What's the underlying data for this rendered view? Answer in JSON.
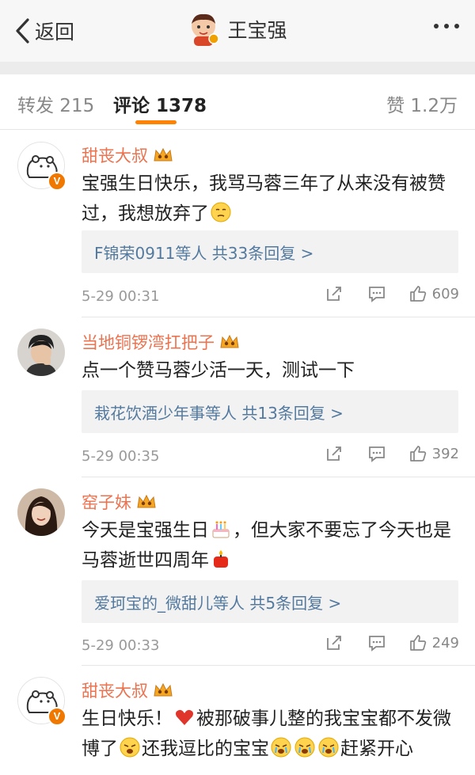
{
  "navbar": {
    "back_label": "返回",
    "title": "王宝强",
    "icons": [
      "back-chevron-icon",
      "user-avatar",
      "more-dots-icon"
    ]
  },
  "tabs": {
    "repost": "转发 215",
    "comments": "评论 1378",
    "likes": "赞 1.2万",
    "accent_color": "#ff8200"
  },
  "colors": {
    "username": "#eb7350",
    "link": "#53799e",
    "verified_badge": "#f07800",
    "heart": "#e0352b"
  },
  "comments": [
    {
      "name": "甜丧大叔",
      "text_a": "宝强生日快乐，我骂马蓉三年了从来没有被赞过，我想放弃了",
      "reply": "F锦荣0911等人  共33条回复 >",
      "time": "5-29 00:31",
      "likes": "609"
    },
    {
      "name": "当地铜锣湾扛把子",
      "text_a": "点一个赞马蓉少活一天，测试一下",
      "reply": "栽花饮酒少年事等人  共13条回复 >",
      "time": "5-29 00:35",
      "likes": "392"
    },
    {
      "name": "窑子妹",
      "text_a": "今天是宝强生日",
      "text_b": "，但大家不要忘了今天也是马蓉逝世四周年",
      "reply": "爱珂宝的_微甜儿等人  共5条回复 >",
      "time": "5-29 00:33",
      "likes": "249"
    },
    {
      "name": "甜丧大叔",
      "text_a": "生日快乐！",
      "text_b": "被那破事儿整的我宝宝都不发微博了",
      "text_c": "还我逗比的宝宝",
      "text_d": "赶紧开心"
    }
  ]
}
